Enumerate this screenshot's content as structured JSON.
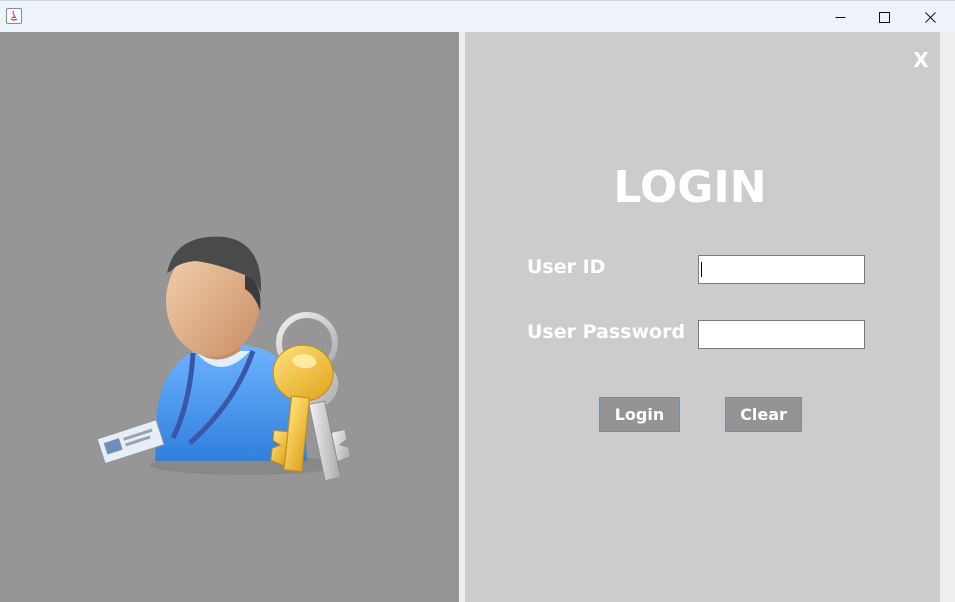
{
  "window": {
    "minimize_icon": "minimize-icon",
    "maximize_icon": "maximize-icon",
    "close_icon": "close-icon",
    "app_icon": "java-app-icon"
  },
  "left_panel": {
    "illustration": "user-with-keys-icon",
    "background_color": "#969696"
  },
  "login_panel": {
    "close_label": "X",
    "title": "LOGIN",
    "user_id_label": "User ID",
    "user_id_value": "",
    "password_label": "User Password",
    "password_value": "",
    "login_button": "Login",
    "clear_button": "Clear",
    "background_color": "#cccccc",
    "button_color": "#949494",
    "text_color": "#ffffff"
  }
}
